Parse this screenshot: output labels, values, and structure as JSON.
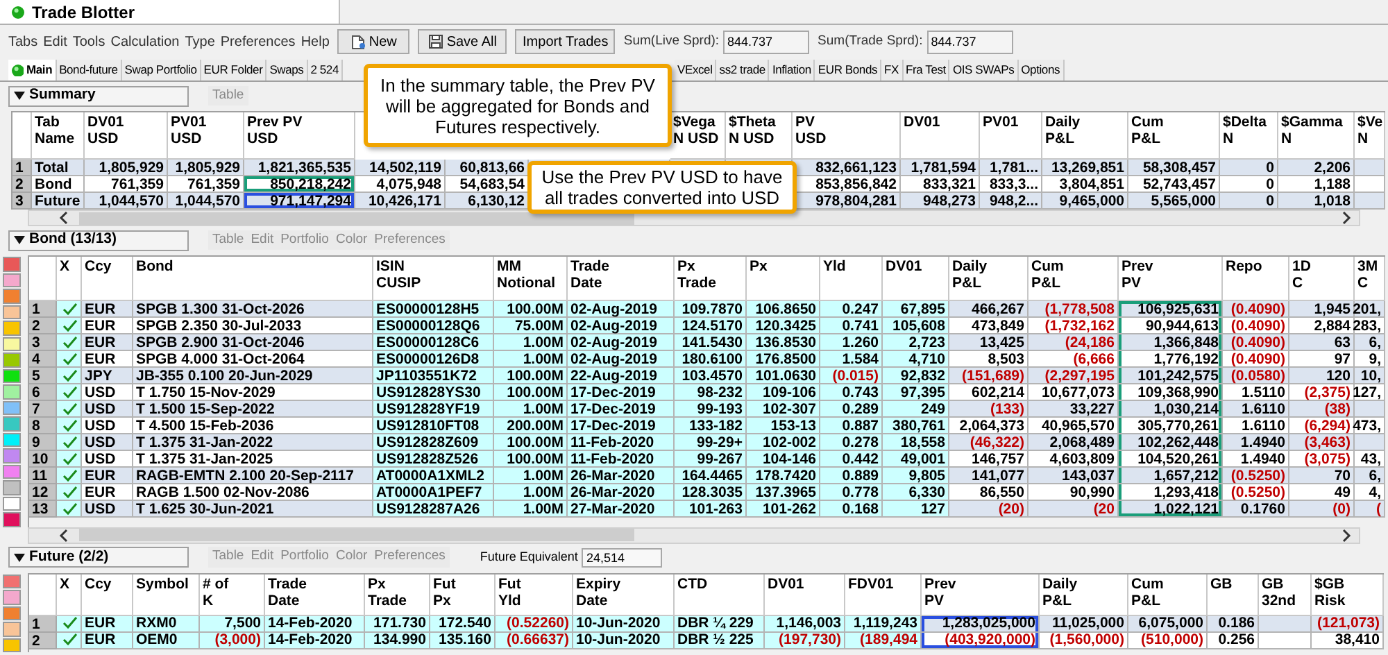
{
  "window": {
    "title": "Trade Blotter"
  },
  "menu": [
    "Tabs",
    "Edit",
    "Tools",
    "Calculation",
    "Type",
    "Preferences",
    "Help"
  ],
  "toolbar": {
    "buttons": [
      {
        "label": "New",
        "kind": "new"
      },
      {
        "label": "Save All",
        "kind": "save"
      },
      {
        "label": "Import Trades",
        "kind": "plain"
      }
    ],
    "fields": [
      {
        "label": "Sum(Live Sprd):",
        "value": "844.737"
      },
      {
        "label": "Sum(Trade Sprd):",
        "value": "844.737"
      }
    ]
  },
  "tabs": [
    {
      "label": "Main",
      "selected": true
    },
    {
      "label": "Bond-future",
      "selected": false
    },
    {
      "label": "Swap Portfolio",
      "selected": false
    },
    {
      "label": "EUR Folder",
      "selected": false
    },
    {
      "label": "Swaps",
      "selected": false
    },
    {
      "label": "2 524",
      "selected": false
    },
    {
      "label": "VExcel",
      "selected": false
    },
    {
      "label": "ss2 trade",
      "selected": false
    },
    {
      "label": "Inflation",
      "selected": false
    },
    {
      "label": "EUR Bonds",
      "selected": false
    },
    {
      "label": "FX",
      "selected": false
    },
    {
      "label": "Fra Test",
      "selected": false
    },
    {
      "label": "OIS SWAPs",
      "selected": false
    },
    {
      "label": "Options",
      "selected": false
    }
  ],
  "callouts": [
    {
      "text": "In the summary table, the Prev PV will be aggregated for Bonds and Futures respectively."
    },
    {
      "text": "Use the Prev PV USD to have all trades converted into USD"
    }
  ],
  "summary": {
    "title": "Summary",
    "menu": [
      "Table"
    ],
    "columns": [
      {
        "label": "Tab\nName",
        "left_aligned": true
      },
      {
        "label": "DV01\nUSD"
      },
      {
        "label": "PV01\nUSD"
      },
      {
        "label": "Prev PV\nUSD"
      },
      {},
      {},
      {},
      {
        "label": "$Vega\nN USD"
      },
      {
        "label": "$Theta\nN USD"
      },
      {
        "label": "PV\nUSD"
      },
      {
        "label": "DV01"
      },
      {
        "label": "PV01"
      },
      {
        "label": "Daily\nP&L"
      },
      {
        "label": "Cum\nP&L"
      },
      {
        "label": "$Delta\nN"
      },
      {
        "label": "$Gamma\nN"
      },
      {
        "label": "$Ve\nN"
      }
    ],
    "rows": [
      {
        "num": "1",
        "cells": [
          "Total",
          "1,805,929",
          "1,805,929",
          "1,821,365,535",
          "14,502,119",
          "60,813,66",
          null,
          null,
          null,
          "832,661,123",
          "1,781,594",
          "1,781...",
          "13,269,851",
          "58,308,457",
          "0",
          "2,206",
          null
        ]
      },
      {
        "num": "2",
        "cells": [
          "Bond",
          "761,359",
          "761,359",
          {
            "t": "850,218,242",
            "outline": {
              "color": "#1a9e7a"
            }
          },
          "4,075,948",
          "54,683,54",
          null,
          null,
          null,
          "853,856,842",
          "833,321",
          "833,3...",
          "3,804,851",
          "52,743,457",
          "0",
          "1,188",
          null
        ]
      },
      {
        "num": "3",
        "cells": [
          "Future",
          "1,044,570",
          "1,044,570",
          {
            "t": "971,147,294",
            "outline": {
              "color": "#2a4fe0"
            }
          },
          "10,426,171",
          "6,130,12",
          null,
          null,
          null,
          "978,804,281",
          "948,273",
          "948,2...",
          "9,465,000",
          "5,565,000",
          "0",
          "1,018",
          null
        ]
      }
    ]
  },
  "bond": {
    "title": "Bond (13/13)",
    "menu": [
      "Table",
      "Edit",
      "Portfolio",
      "Color",
      "Preferences"
    ],
    "palette": [
      {
        "color": "#e85858"
      },
      {
        "color": "#f4a8cc"
      },
      {
        "color": "#f08030"
      },
      {
        "color": "#f8c498"
      },
      {
        "color": "#f8c400"
      },
      {
        "color": "#f8f8a0"
      },
      {
        "color": "#98c800"
      },
      {
        "color": "#10e010"
      },
      {
        "color": "#a0f0a0"
      },
      {
        "color": "#80c0f8"
      },
      {
        "color": "#38c8c0"
      },
      {
        "color": "#00f0f8"
      },
      {
        "color": "#c088f0"
      },
      {
        "color": "#f080f0"
      },
      {
        "color": "#c0c0c0"
      },
      {
        "color": "#ffffff"
      },
      {
        "color": "#e0105c"
      }
    ],
    "columns": [
      {
        "label": "X",
        "kind": "check",
        "color": "#ccffff"
      },
      {
        "label": "Ccy",
        "left_aligned": true
      },
      {
        "label": "Bond",
        "left_aligned": true
      },
      {
        "label": "ISIN\nCUSIP",
        "left_aligned": true,
        "color": "#ccffff"
      },
      {
        "label": "MM\nNotional",
        "color": "#ccffff"
      },
      {
        "label": "Trade\nDate",
        "left_aligned": true,
        "color": "#ccffff"
      },
      {
        "label": "Px\nTrade",
        "color": "#ccffff"
      },
      {
        "label": "Px",
        "color": "#ccffff"
      },
      {
        "label": "Yld",
        "color": "#ccffff"
      },
      {
        "label": "DV01",
        "color": "#ccffff"
      },
      {
        "label": "Daily\nP&L"
      },
      {
        "label": "Cum\nP&L"
      },
      {
        "label": "Prev\nPV",
        "outline": {
          "color": "#1a9e7a"
        }
      },
      {
        "label": "Repo"
      },
      {
        "label": "1D\nC"
      },
      {
        "label": "3M\nC"
      }
    ],
    "rows": [
      {
        "num": "1",
        "checked": true,
        "cells": [
          null,
          "EUR",
          "SPGB 1.300 31-Oct-2026",
          "ES00000128H5",
          "100.00M",
          "02-Aug-2019",
          "109.7870",
          "106.8650",
          "0.247",
          "67,895",
          "466,267",
          {
            "t": "(1,778,508",
            "negative": true
          },
          "106,925,631",
          {
            "t": "(0.4090)",
            "negative": true
          },
          "1,945",
          "201,"
        ]
      },
      {
        "num": "2",
        "checked": true,
        "cells": [
          null,
          "EUR",
          "SPGB 2.350 30-Jul-2033",
          "ES00000128Q6",
          "75.00M",
          "02-Aug-2019",
          "124.5170",
          "120.3425",
          "0.741",
          "105,608",
          "473,849",
          {
            "t": "(1,732,162",
            "negative": true
          },
          "90,944,613",
          {
            "t": "(0.4090)",
            "negative": true
          },
          "2,884",
          "283,"
        ]
      },
      {
        "num": "3",
        "checked": true,
        "cells": [
          null,
          "EUR",
          "SPGB 2.900 31-Oct-2046",
          "ES00000128C6",
          "1.00M",
          "02-Aug-2019",
          "141.5430",
          "136.8530",
          "1.260",
          "2,723",
          "13,425",
          {
            "t": "(24,186",
            "negative": true
          },
          "1,366,848",
          {
            "t": "(0.4090)",
            "negative": true
          },
          "63",
          "6,"
        ]
      },
      {
        "num": "4",
        "checked": true,
        "cells": [
          null,
          "EUR",
          "SPGB 4.000 31-Oct-2064",
          "ES00000126D8",
          "1.00M",
          "02-Aug-2019",
          "180.6100",
          "176.8500",
          "1.584",
          "4,710",
          "8,503",
          {
            "t": "(6,666",
            "negative": true
          },
          "1,776,192",
          {
            "t": "(0.4090)",
            "negative": true
          },
          "97",
          "9,"
        ]
      },
      {
        "num": "5",
        "checked": true,
        "cells": [
          null,
          "JPY",
          "JB-355 0.100 20-Jun-2029",
          "JP1103551K72",
          "100.00M",
          "22-Aug-2019",
          "103.4570",
          "101.0630",
          {
            "t": "(0.015)",
            "negative": true
          },
          "92,832",
          {
            "t": "(151,689)",
            "negative": true
          },
          {
            "t": "(2,297,195",
            "negative": true
          },
          "101,242,575",
          {
            "t": "(0.0580)",
            "negative": true
          },
          "120",
          "10,"
        ]
      },
      {
        "num": "6",
        "checked": true,
        "cells": [
          null,
          "USD",
          "T 1.750 15-Nov-2029",
          "US912828YS30",
          "100.00M",
          "17-Dec-2019",
          "98-232",
          "109-106",
          "0.743",
          "97,395",
          "602,214",
          "10,677,073",
          "109,368,990",
          "1.5110",
          {
            "t": "(2,375)",
            "negative": true
          },
          "127,"
        ]
      },
      {
        "num": "7",
        "checked": true,
        "cells": [
          null,
          "USD",
          "T 1.500 15-Sep-2022",
          "US912828YF19",
          "1.00M",
          "17-Dec-2019",
          "99-193",
          "102-307",
          "0.289",
          "249",
          {
            "t": "(133)",
            "negative": true
          },
          "33,227",
          "1,030,214",
          "1.6110",
          {
            "t": "(38)",
            "negative": true
          },
          null
        ]
      },
      {
        "num": "8",
        "checked": true,
        "cells": [
          null,
          "USD",
          "T 4.500 15-Feb-2036",
          "US912810FT08",
          "200.00M",
          "17-Dec-2019",
          "133-182",
          "153-13",
          "0.887",
          "380,761",
          "2,064,373",
          "40,965,570",
          "305,770,261",
          "1.6110",
          {
            "t": "(6,294)",
            "negative": true
          },
          "473,"
        ]
      },
      {
        "num": "9",
        "checked": true,
        "cells": [
          null,
          "USD",
          "T 1.375 31-Jan-2022",
          "US912828Z609",
          "100.00M",
          "11-Feb-2020",
          "99-29+",
          "102-002",
          "0.278",
          "18,558",
          {
            "t": "(46,322)",
            "negative": true
          },
          "2,068,489",
          "102,262,448",
          "1.4940",
          {
            "t": "(3,463)",
            "negative": true
          },
          null
        ]
      },
      {
        "num": "10",
        "checked": true,
        "cells": [
          null,
          "USD",
          "T 1.375 31-Jan-2025",
          "US912828Z526",
          "100.00M",
          "11-Feb-2020",
          "99-267",
          "104-146",
          "0.442",
          "49,001",
          "146,757",
          "4,603,809",
          "104,520,261",
          "1.4940",
          {
            "t": "(3,075)",
            "negative": true
          },
          "43,"
        ]
      },
      {
        "num": "11",
        "checked": true,
        "cells": [
          null,
          "EUR",
          "RAGB-EMTN 2.100 20-Sep-2117",
          "AT0000A1XML2",
          "1.00M",
          "26-Mar-2020",
          "164.4465",
          "178.7420",
          "0.889",
          "9,805",
          "141,077",
          "143,037",
          "1,657,212",
          {
            "t": "(0.5250)",
            "negative": true
          },
          "70",
          "6,"
        ]
      },
      {
        "num": "12",
        "checked": true,
        "cells": [
          null,
          "EUR",
          "RAGB 1.500 02-Nov-2086",
          "AT0000A1PEF7",
          "1.00M",
          "26-Mar-2020",
          "128.3035",
          "137.3965",
          "0.778",
          "6,330",
          "86,550",
          "90,990",
          "1,293,418",
          {
            "t": "(0.5250)",
            "negative": true
          },
          "49",
          "4,"
        ]
      },
      {
        "num": "13",
        "checked": true,
        "cells": [
          null,
          "USD",
          "T 1.625 30-Jun-2021",
          "US9128287A26",
          "1.00M",
          "27-Mar-2020",
          "101-263",
          "101-262",
          "0.168",
          "127",
          {
            "t": "(20)",
            "negative": true
          },
          {
            "t": "(20",
            "negative": true
          },
          "1,022,121",
          "0.1760",
          {
            "t": "(0)",
            "negative": true
          },
          {
            "t": "(",
            "negative": true
          }
        ]
      }
    ]
  },
  "future": {
    "title": "Future (2/2)",
    "menu": [
      "Table",
      "Edit",
      "Portfolio",
      "Color",
      "Preferences"
    ],
    "equivalent": {
      "label": "Future Equivalent",
      "value": "24,514"
    },
    "palette": [
      {
        "color": "#f07070"
      },
      {
        "color": "#f4a8cc"
      },
      {
        "color": "#f08030"
      },
      {
        "color": "#f8c498"
      },
      {
        "color": "#f8c400"
      }
    ],
    "columns": [
      {
        "label": "X",
        "kind": "check",
        "color": "#ccffff"
      },
      {
        "label": "Ccy",
        "left_aligned": true,
        "color": "#ccffff"
      },
      {
        "label": "Symbol",
        "left_aligned": true,
        "color": "#ccffff"
      },
      {
        "label": "# of\nK",
        "color": "#ccffff"
      },
      {
        "label": "Trade\nDate",
        "left_aligned": true,
        "color": "#ccffff"
      },
      {
        "label": "Px\nTrade",
        "color": "#ccffff"
      },
      {
        "label": "Fut\nPx",
        "color": "#ccffff"
      },
      {
        "label": "Fut\nYld",
        "color": "#ccffff"
      },
      {
        "label": "Expiry\nDate",
        "left_aligned": true,
        "color": "#ccffff"
      },
      {
        "label": "CTD",
        "left_aligned": true,
        "color": "#ccffff"
      },
      {
        "label": "DV01",
        "color": "#ccffff"
      },
      {
        "label": "FDV01",
        "color": "#ccffff"
      },
      {
        "label": "Prev\nPV",
        "outline": {
          "color": "#2a4fe0"
        }
      },
      {
        "label": "Daily\nP&L"
      },
      {
        "label": "Cum\nP&L"
      },
      {
        "label": "GB"
      },
      {
        "label": "GB\n32nd"
      },
      {
        "label": "$GB\nRisk"
      }
    ],
    "rows": [
      {
        "num": "1",
        "checked": true,
        "cells": [
          null,
          "EUR",
          "RXM0",
          "7,500",
          "14-Feb-2020",
          "171.730",
          "172.540",
          {
            "t": "(0.52260)",
            "negative": true
          },
          "10-Jun-2020",
          "DBR ¼ 229",
          "1,146,003",
          "1,119,243",
          "1,283,025,000",
          "11,025,000",
          "6,075,000",
          "0.186",
          null,
          {
            "t": "(121,073)",
            "negative": true
          }
        ]
      },
      {
        "num": "2",
        "checked": true,
        "cells": [
          null,
          "EUR",
          "OEM0",
          {
            "t": "(3,000)",
            "negative": true
          },
          "14-Feb-2020",
          "134.990",
          "135.160",
          {
            "t": "(0.66637)",
            "negative": true
          },
          "10-Jun-2020",
          "DBR ½ 225",
          {
            "t": "(197,730)",
            "negative": true
          },
          {
            "t": "(189,494",
            "negative": true
          },
          {
            "t": "(403,920,000)",
            "negative": true
          },
          {
            "t": "(1,560,000)",
            "negative": true
          },
          {
            "t": "(510,000)",
            "negative": true
          },
          "0.256",
          null,
          "38,410"
        ]
      }
    ]
  }
}
